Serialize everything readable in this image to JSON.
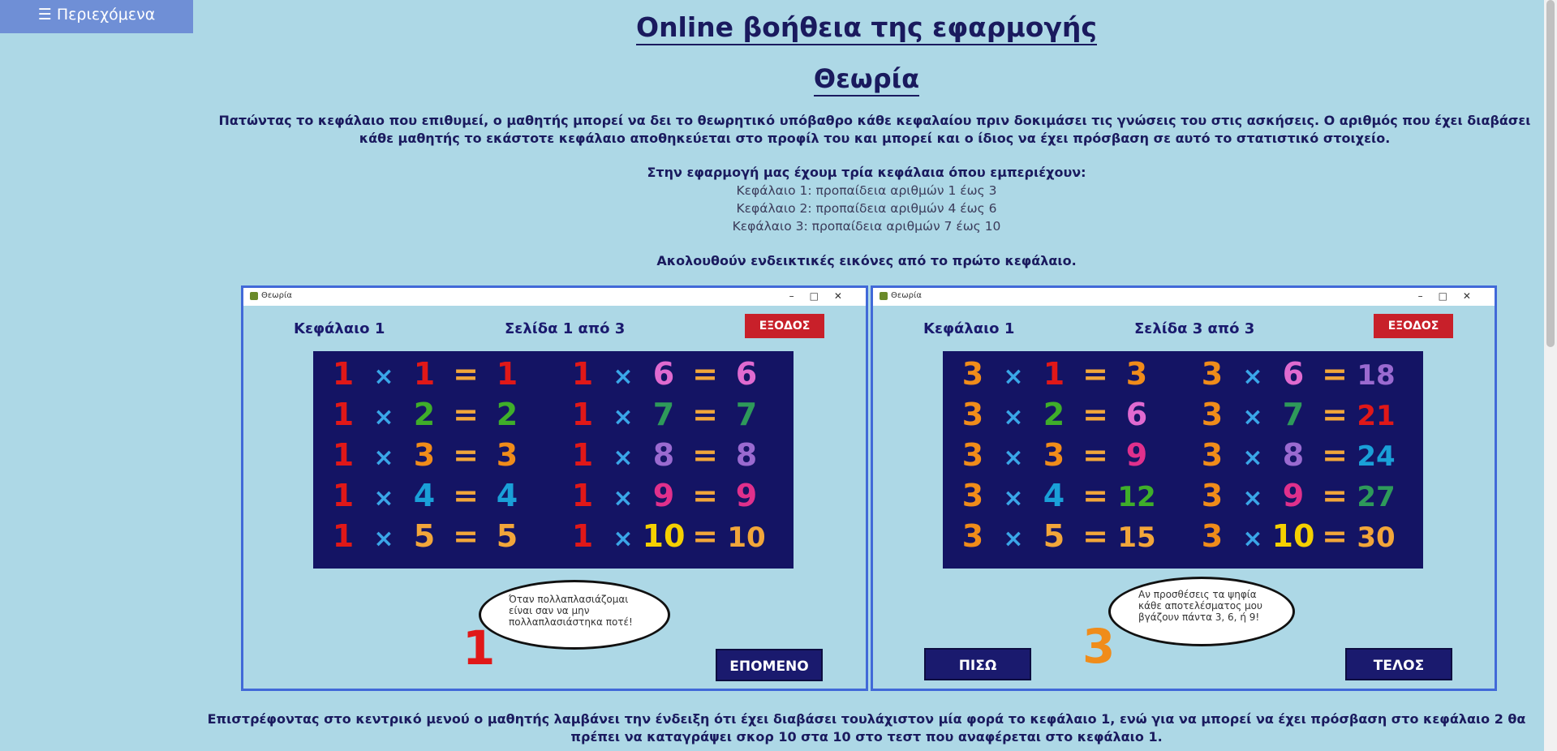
{
  "menu": {
    "label": "☰ Περιεχόμενα"
  },
  "header": {
    "title": "Online βοήθεια της εφαρμογής",
    "subtitle": "Θεωρία"
  },
  "intro": "Πατώντας το κεφάλαιο που επιθυμεί, ο μαθητής μπορεί να δει το θεωρητικό υπόβαθρο κάθε κεφαλαίου πριν δοκιμάσει τις γνώσεις του στις ασκήσεις. Ο αριθμός που έχει διαβάσει κάθε μαθητής το εκάστοτε κεφάλαιο αποθηκεύεται στο προφίλ του και μπορεί και ο ίδιος να έχει πρόσβαση σε αυτό το στατιστικό στοιχείο.",
  "chapters": {
    "heading": "Στην εφαρμογή μας έχουμ τρία κεφάλαια όπου εμπεριέχουν:",
    "items": [
      "Κεφάλαιο 1: προπαίδεια αριθμών 1 έως 3",
      "Κεφάλαιο 2: προπαίδεια αριθμών 4 έως 6",
      "Κεφάλαιο 3: προπαίδεια αριθμών 7 έως 10"
    ]
  },
  "follow_text": "Ακολουθούν ενδεικτικές εικόνες από το πρώτο κεφάλαιο.",
  "screenshots": [
    {
      "window_title": "Θεωρία",
      "chapter": "Κεφάλαιο 1",
      "page": "Σελίδα 1 από 3",
      "exit": "ΕΞΟΔΟΣ",
      "bubble": "Όταν πολλαπλασιάζομαι είναι σαν να μην πολλαπλασιάστηκα ποτέ!",
      "character": "1",
      "left_col": [
        [
          "1",
          "1",
          "1"
        ],
        [
          "1",
          "2",
          "2"
        ],
        [
          "1",
          "3",
          "3"
        ],
        [
          "1",
          "4",
          "4"
        ],
        [
          "1",
          "5",
          "5"
        ]
      ],
      "right_col": [
        [
          "1",
          "6",
          "6"
        ],
        [
          "1",
          "7",
          "7"
        ],
        [
          "1",
          "8",
          "8"
        ],
        [
          "1",
          "9",
          "9"
        ],
        [
          "1",
          "10",
          "10"
        ]
      ],
      "next": "ΕΠΟΜΕΝΟ"
    },
    {
      "window_title": "Θεωρία",
      "chapter": "Κεφάλαιο 1",
      "page": "Σελίδα 3 από 3",
      "exit": "ΕΞΟΔΟΣ",
      "bubble": "Αν προσθέσεις τα ψηφία κάθε αποτελέσματος μου βγάζουν πάντα 3, 6, ή 9!",
      "character": "3",
      "left_col": [
        [
          "3",
          "1",
          "3"
        ],
        [
          "3",
          "2",
          "6"
        ],
        [
          "3",
          "3",
          "9"
        ],
        [
          "3",
          "4",
          "12"
        ],
        [
          "3",
          "5",
          "15"
        ]
      ],
      "right_col": [
        [
          "3",
          "6",
          "18"
        ],
        [
          "3",
          "7",
          "21"
        ],
        [
          "3",
          "8",
          "24"
        ],
        [
          "3",
          "9",
          "27"
        ],
        [
          "3",
          "10",
          "30"
        ]
      ],
      "back": "ΠΙΣΩ",
      "end": "ΤΕΛΟΣ"
    }
  ],
  "outro": "Επιστρέφοντας στο κεντρικό μενού ο μαθητής λαμβάνει την ένδειξη ότι έχει διαβάσει τουλάχιστον μία φορά το κεφάλαιο 1, ενώ για να μπορεί να έχει πρόσβαση στο κεφάλαιο 2 θα πρέπει να καταγράψει σκορ 10 στα 10 στο τεστ που αναφέρεται στο κεφάλαιο 1.",
  "symbols": {
    "times": "×",
    "equals": "="
  },
  "colors": {
    "background": "#add8e6",
    "menu": "#6f8fd6",
    "heading": "#1a1a5e",
    "board": "#141464",
    "exit_button": "#c8202a",
    "nav_button": "#1a1a6e",
    "frame": "#4169d8"
  }
}
